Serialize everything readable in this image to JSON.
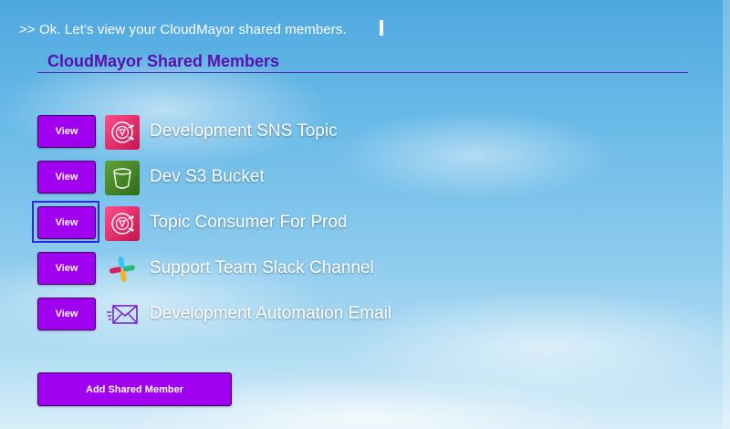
{
  "prompt": {
    "text": ">> Ok. Let's view your CloudMayor shared members."
  },
  "section": {
    "title": "CloudMayor Shared Members"
  },
  "members": [
    {
      "view_label": "View",
      "name": "Development SNS Topic",
      "icon": "sns-topic-icon",
      "icon_color": "#d6246e"
    },
    {
      "view_label": "View",
      "name": "Dev S3 Bucket",
      "icon": "s3-bucket-icon",
      "icon_color": "#3f8624"
    },
    {
      "view_label": "View",
      "name": "Topic Consumer For Prod",
      "icon": "sns-topic-icon",
      "icon_color": "#d6246e",
      "focused": true
    },
    {
      "view_label": "View",
      "name": "Support Team Slack Channel",
      "icon": "slack-icon"
    },
    {
      "view_label": "View",
      "name": "Development Automation Email",
      "icon": "email-icon",
      "icon_color": "#7b1fd6"
    }
  ],
  "add_button": {
    "label": "Add Shared Member"
  },
  "colors": {
    "accent": "#a100f0",
    "heading": "#5a0fae",
    "focus": "#2a2ae0"
  }
}
